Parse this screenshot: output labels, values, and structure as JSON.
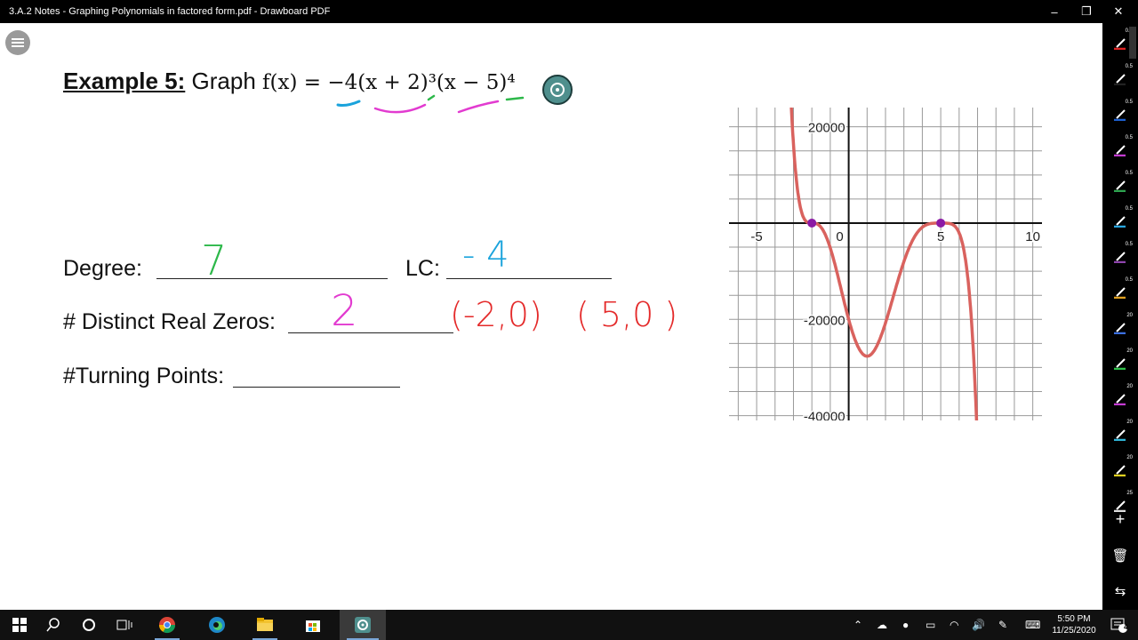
{
  "window": {
    "title": "3.A.2 Notes - Graphing Polynomials in factored form.pdf - Drawboard PDF",
    "minimize": "–",
    "restore": "❐",
    "close": "✕"
  },
  "document": {
    "example_label": "Example 5:",
    "example_text": "Graph",
    "equation": "f(x) = −4(x + 2)³(x − 5)⁴",
    "degree_label": "Degree:",
    "degree_answer": "7",
    "lc_label": "LC:",
    "lc_answer": "- 4",
    "zeros_label": "# Distinct Real Zeros:",
    "zeros_answer": "2",
    "zero1": "(-2,0)",
    "zero2": "( 5,0 )",
    "turning_label": "#Turning Points:"
  },
  "chart_data": {
    "type": "line",
    "function": "f(x) = -4(x + 2)^3(x - 5)^4",
    "x_tick_labels": [
      "-5",
      "0",
      "5",
      "10"
    ],
    "y_tick_labels": [
      "20000",
      "-20000",
      "-40000"
    ],
    "xlim": [
      -6.5,
      10.5
    ],
    "ylim": [
      -41000,
      24000
    ],
    "grid": true,
    "curve_color": "#d9625e",
    "marked_points": [
      {
        "x": -2,
        "y": 0,
        "color": "#8b1aa5"
      },
      {
        "x": 5,
        "y": 0,
        "color": "#8b1aa5"
      }
    ]
  },
  "colors": {
    "ink_green": "#2db84a",
    "ink_blue": "#1aa3dc",
    "ink_magenta": "#e23bd0",
    "ink_red": "#e42a2a",
    "sidebar_bg": "#000000"
  },
  "sidebar": {
    "tools": [
      {
        "size": "0.5",
        "color": "#e02424"
      },
      {
        "size": "0.5",
        "color": "#222222"
      },
      {
        "size": "0.5",
        "color": "#1c5fcf"
      },
      {
        "size": "0.5",
        "color": "#c43bd1"
      },
      {
        "size": "0.5",
        "color": "#2ea44f"
      },
      {
        "size": "0.5",
        "color": "#29a6e0"
      },
      {
        "size": "0.5",
        "color": "#8e44ad"
      },
      {
        "size": "0.5",
        "color": "#e0a020"
      },
      {
        "size": "20",
        "color": "#3b6fe0"
      },
      {
        "size": "20",
        "color": "#2ec14a"
      },
      {
        "size": "20",
        "color": "#c43bd1"
      },
      {
        "size": "20",
        "color": "#2fb4d6"
      },
      {
        "size": "20",
        "color": "#e0d020"
      },
      {
        "size": "25",
        "color": "#dddddd"
      }
    ],
    "add_icon": "+",
    "delete_icon": "🗑",
    "swap_icon": "⇆"
  },
  "taskbar": {
    "time": "5:50 PM",
    "date": "11/25/2020",
    "notification_count": "4"
  }
}
